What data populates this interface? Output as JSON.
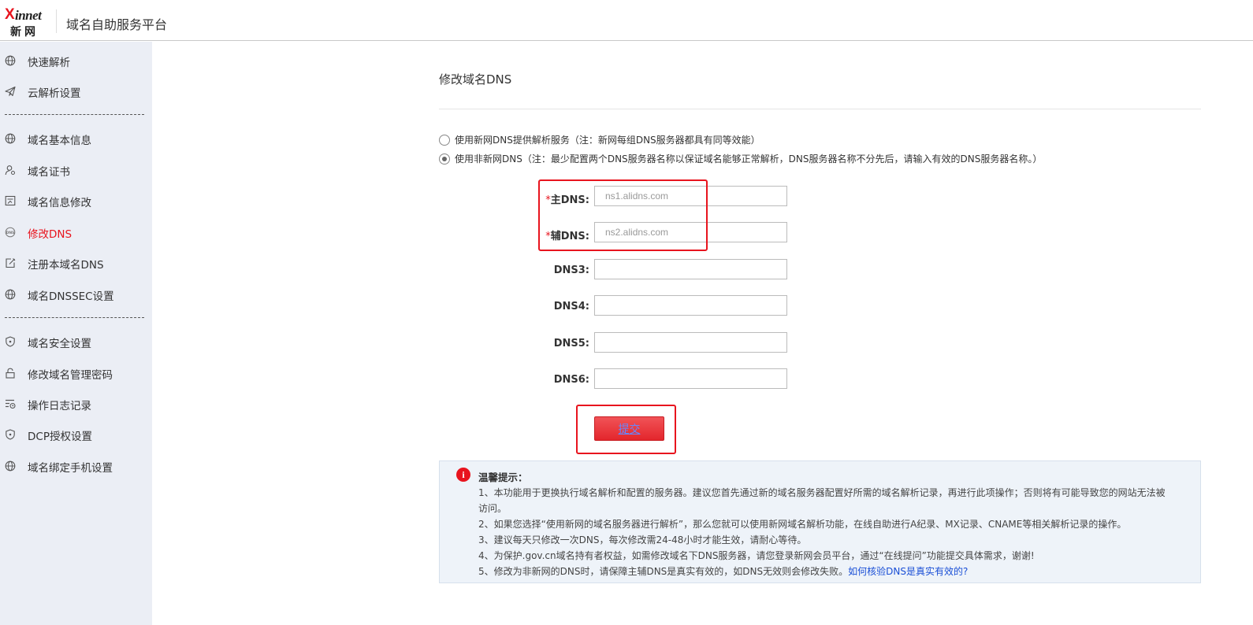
{
  "header": {
    "logo_x": "X",
    "logo_innet": "innet",
    "logo_cn": "新网",
    "title": "域名自助服务平台"
  },
  "sidebar": {
    "items": [
      {
        "label": "快速解析",
        "icon": "globe-icon"
      },
      {
        "label": "云解析设置",
        "icon": "paper-plane-icon"
      },
      {
        "label": "域名基本信息",
        "icon": "globe-icon"
      },
      {
        "label": "域名证书",
        "icon": "user-certificate-icon"
      },
      {
        "label": "域名信息修改",
        "icon": "edit-info-icon"
      },
      {
        "label": "修改DNS",
        "icon": "dns-icon",
        "active": true
      },
      {
        "label": "注册本域名DNS",
        "icon": "edit-icon"
      },
      {
        "label": "域名DNSSEC设置",
        "icon": "globe-icon"
      },
      {
        "label": "域名安全设置",
        "icon": "shield-icon"
      },
      {
        "label": "修改域名管理密码",
        "icon": "lock-icon"
      },
      {
        "label": "操作日志记录",
        "icon": "log-icon"
      },
      {
        "label": "DCP授权设置",
        "icon": "shield-icon"
      },
      {
        "label": "域名绑定手机设置",
        "icon": "globe-icon"
      }
    ],
    "active_color": "#e8141e"
  },
  "main": {
    "title": "修改域名DNS",
    "options": [
      {
        "label": "使用新网DNS提供解析服务（注：新网每组DNS服务器都具有同等效能）",
        "checked": false
      },
      {
        "label": "使用非新网DNS（注：最少配置两个DNS服务器名称以保证域名能够正常解析，DNS服务器名称不分先后，请输入有效的DNS服务器名称。）",
        "checked": true
      }
    ],
    "fields": [
      {
        "required": "*",
        "label": "主DNS:",
        "value": "",
        "placeholder": "ns1.alidns.com"
      },
      {
        "required": "*",
        "label": "辅DNS:",
        "value": "",
        "placeholder": "ns2.alidns.com"
      },
      {
        "required": "",
        "label": "DNS3:",
        "value": "",
        "placeholder": ""
      },
      {
        "required": "",
        "label": "DNS4:",
        "value": "",
        "placeholder": ""
      },
      {
        "required": "",
        "label": "DNS5:",
        "value": "",
        "placeholder": ""
      },
      {
        "required": "",
        "label": "DNS6:",
        "value": "",
        "placeholder": ""
      }
    ],
    "submit_label": "提交",
    "tips": {
      "icon_glyph": "i",
      "title": "温馨提示：",
      "lines": [
        "1、本功能用于更换执行域名解析和配置的服务器。建议您首先通过新的域名服务器配置好所需的域名解析记录，再进行此项操作；否则将有可能导致您的网站无法被",
        "访问。",
        "2、如果您选择“使用新网的域名服务器进行解析”，那么您就可以使用新网域名解析功能，在线自助进行A纪录、MX记录、CNAME等相关解析记录的操作。",
        "3、建议每天只修改一次DNS，每次修改需24-48小时才能生效，请耐心等待。",
        "4、为保护.gov.cn域名持有者权益，如需修改域名下DNS服务器，请您登录新网会员平台，通过“在线提问”功能提交具体需求，谢谢!",
        "5、修改为非新网的DNS时，请保障主辅DNS是真实有效的，如DNS无效则会修改失败。"
      ],
      "link_text": "如何核验DNS是真实有效的?"
    }
  }
}
